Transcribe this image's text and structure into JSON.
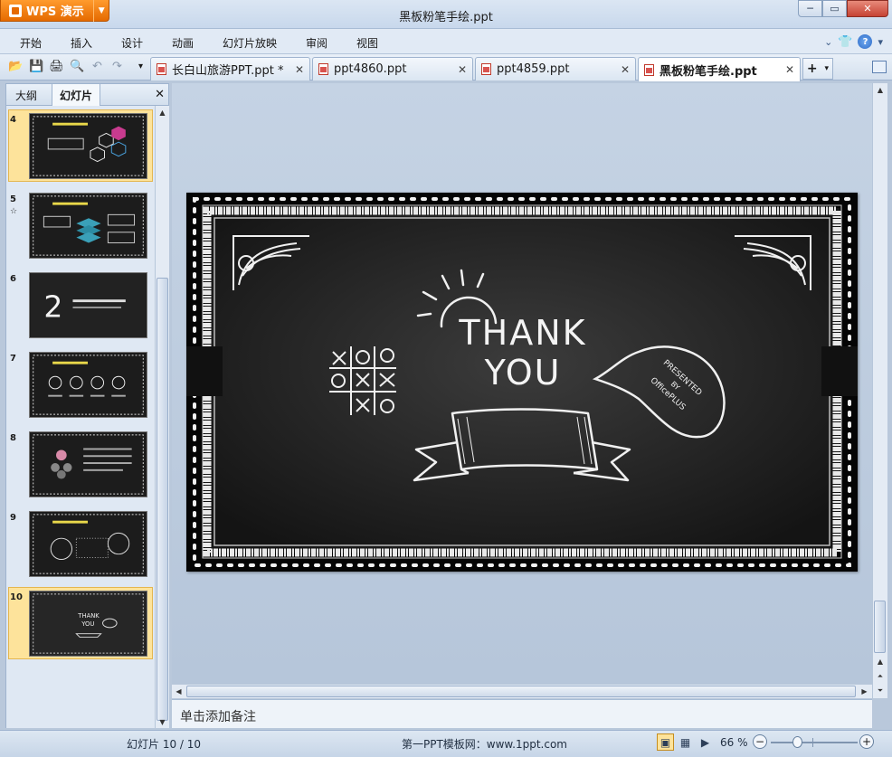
{
  "app": {
    "brand": "WPS 演示",
    "window_title": "黑板粉笔手绘.ppt",
    "controls": {
      "minimize": "─",
      "restore": "▭",
      "close": "✕"
    }
  },
  "menu": {
    "items": [
      "开始",
      "插入",
      "设计",
      "动画",
      "幻灯片放映",
      "审阅",
      "视图"
    ],
    "right": {
      "collapse": "⌄",
      "skin": "👕",
      "help": "?"
    }
  },
  "toolbar": {
    "open": "📂",
    "save": "💾",
    "print": "🖨",
    "preview": "🔍",
    "undo": "↶",
    "redo": "↷",
    "more": "▾"
  },
  "tabs": [
    {
      "label": "长白山旅游PPT.ppt *",
      "active": false
    },
    {
      "label": "ppt4860.ppt",
      "active": false
    },
    {
      "label": "ppt4859.ppt",
      "active": false
    },
    {
      "label": "黑板粉笔手绘.ppt",
      "active": true
    }
  ],
  "tab_add": {
    "plus": "+",
    "caret": "▾"
  },
  "left_panel": {
    "tabs": [
      "大纲",
      "幻灯片"
    ],
    "active_tab": "幻灯片",
    "close": "✕",
    "thumbnails": [
      {
        "num": "4",
        "selected": true
      },
      {
        "num": "5",
        "star": "☆",
        "selected": false
      },
      {
        "num": "6",
        "selected": false,
        "big_text": "2"
      },
      {
        "num": "7",
        "selected": false
      },
      {
        "num": "8",
        "selected": false
      },
      {
        "num": "9",
        "selected": false
      },
      {
        "num": "10",
        "selected": true,
        "mini_text": [
          "THANK",
          "YOU"
        ]
      }
    ]
  },
  "slide": {
    "title_line1": "THANK",
    "title_line2": "YOU",
    "bubble_lines": [
      "PRESENTED",
      "BY",
      "OfficePLUS"
    ],
    "background": "#1c1c1c",
    "chalk": "#f2f2f2"
  },
  "notes": {
    "placeholder": "单击添加备注"
  },
  "status": {
    "slide_counter": "幻灯片 10 / 10",
    "template_site": "第一PPT模板网：www.1ppt.com",
    "zoom": "66 %",
    "zoom_minus": "−",
    "zoom_plus": "+"
  },
  "colors": {
    "accent": "#ff8c1a",
    "chrome": "#c8d8ec",
    "selected_thumb": "#fde39b"
  }
}
